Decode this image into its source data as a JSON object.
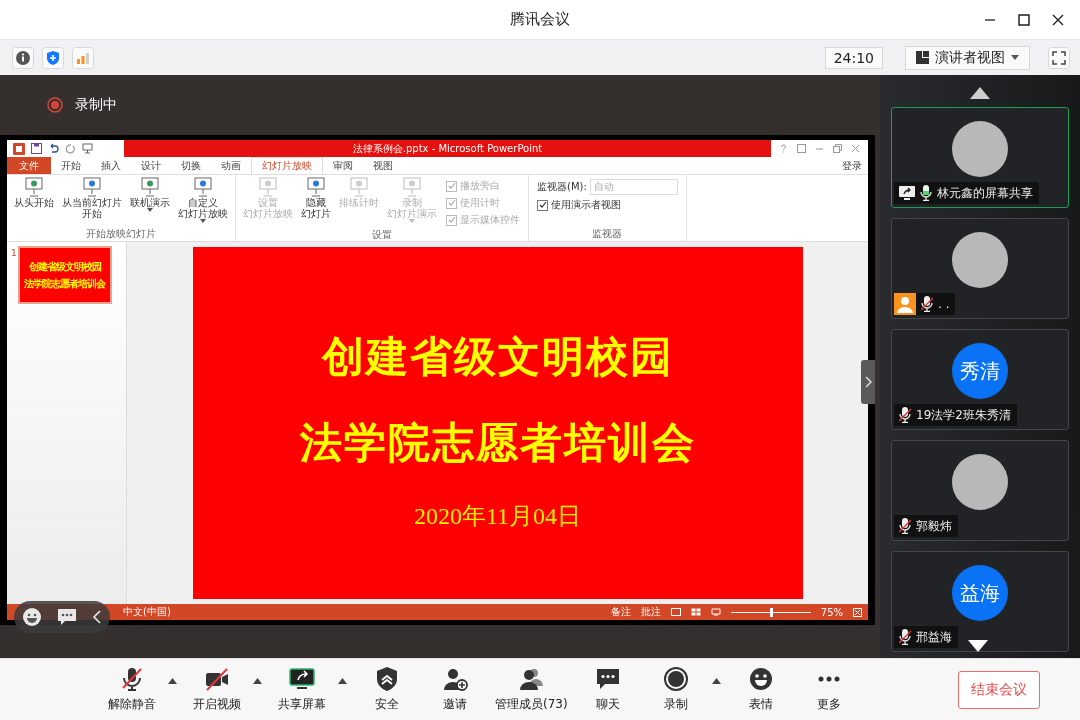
{
  "window": {
    "title": "腾讯会议"
  },
  "top_bar": {
    "timer": "24:10",
    "view_button": "演讲者视图"
  },
  "recording": {
    "label": "录制中"
  },
  "powerpoint": {
    "title": "法律系例会.pptx - Microsoft PowerPoint",
    "sign_in": "登录",
    "tabs": [
      {
        "label": "文件",
        "kind": "file",
        "selected": false
      },
      {
        "label": "开始",
        "kind": "tab",
        "selected": false
      },
      {
        "label": "插入",
        "kind": "tab",
        "selected": false
      },
      {
        "label": "设计",
        "kind": "tab",
        "selected": false
      },
      {
        "label": "切换",
        "kind": "tab",
        "selected": false
      },
      {
        "label": "动画",
        "kind": "tab",
        "selected": false
      },
      {
        "label": "幻灯片放映",
        "kind": "tab",
        "selected": true
      },
      {
        "label": "审阅",
        "kind": "tab",
        "selected": false
      },
      {
        "label": "视图",
        "kind": "tab",
        "selected": false
      }
    ],
    "groups": [
      {
        "label": "开始放映幻灯片",
        "buttons": [
          {
            "lines": [
              "从头开始"
            ],
            "disabled": false,
            "dropdown": false
          },
          {
            "lines": [
              "从当前幻灯片",
              "开始"
            ],
            "disabled": false,
            "dropdown": false
          },
          {
            "lines": [
              "联机演示"
            ],
            "disabled": false,
            "dropdown": true
          },
          {
            "lines": [
              "自定义",
              "幻灯片放映"
            ],
            "disabled": false,
            "dropdown": true
          }
        ]
      },
      {
        "label": "设置",
        "buttons": [
          {
            "lines": [
              "设置",
              "幻灯片放映"
            ],
            "disabled": true,
            "dropdown": false
          },
          {
            "lines": [
              "隐藏",
              "幻灯片"
            ],
            "disabled": false,
            "dropdown": false
          },
          {
            "lines": [
              "排练计时"
            ],
            "disabled": true,
            "dropdown": false
          },
          {
            "lines": [
              "录制",
              "幻灯片演示"
            ],
            "disabled": true,
            "dropdown": true
          }
        ],
        "checkboxes": [
          {
            "label": "播放旁白",
            "checked": true,
            "disabled": true
          },
          {
            "label": "使用计时",
            "checked": true,
            "disabled": true
          },
          {
            "label": "显示媒体控件",
            "checked": true,
            "disabled": true
          }
        ]
      },
      {
        "label": "监视器",
        "monitor": {
          "label": "监视器(M):",
          "value": "自动",
          "disabled": true
        },
        "checkboxes": [
          {
            "label": "使用演示者视图",
            "checked": true,
            "disabled": false
          }
        ]
      }
    ],
    "thumbnail": {
      "number": "1",
      "lines": [
        "创建省级文明校园",
        "法学院志愿者培训会"
      ]
    },
    "slide": {
      "title_lines": [
        "创建省级文明校园",
        "法学院志愿者培训会"
      ],
      "date": "2020年11月04日"
    },
    "status_bar": {
      "language": "中文(中国)",
      "notes": "备注",
      "comments": "批注",
      "zoom": "75%",
      "zoom_slider": {
        "level": 0.5
      }
    }
  },
  "participants": [
    {
      "name": "林元鑫的屏幕共享",
      "avatar": {
        "kind": "photo"
      },
      "muted": false,
      "sharing": true,
      "badge": false,
      "selected": true
    },
    {
      "name": ". .",
      "avatar": {
        "kind": "photo"
      },
      "muted": true,
      "sharing": false,
      "badge": true,
      "selected": false
    },
    {
      "name": "19法学2班朱秀清",
      "avatar": {
        "kind": "initials",
        "text": "秀清"
      },
      "muted": true,
      "sharing": false,
      "badge": false,
      "selected": false
    },
    {
      "name": "郭毅炜",
      "avatar": {
        "kind": "photo"
      },
      "muted": true,
      "sharing": false,
      "badge": false,
      "selected": false
    },
    {
      "name": "邢益海",
      "avatar": {
        "kind": "initials",
        "text": "益海"
      },
      "muted": true,
      "sharing": false,
      "badge": false,
      "selected": false
    }
  ],
  "toolbar": [
    {
      "label": "解除静音",
      "kind": "mic-off",
      "menu": true
    },
    {
      "label": "开启视频",
      "kind": "video-off",
      "menu": true
    },
    {
      "label": "共享屏幕",
      "kind": "share",
      "menu": true
    },
    {
      "label": "安全",
      "kind": "shield",
      "menu": false
    },
    {
      "label": "邀请",
      "kind": "invite",
      "menu": false
    },
    {
      "label": "管理成员(73)",
      "kind": "members",
      "menu": false
    },
    {
      "label": "聊天",
      "kind": "chat",
      "menu": false
    },
    {
      "label": "录制",
      "kind": "record",
      "menu": true
    },
    {
      "label": "表情",
      "kind": "emoji",
      "menu": false
    },
    {
      "label": "更多",
      "kind": "more",
      "menu": false
    }
  ],
  "end_button": "结束会议"
}
